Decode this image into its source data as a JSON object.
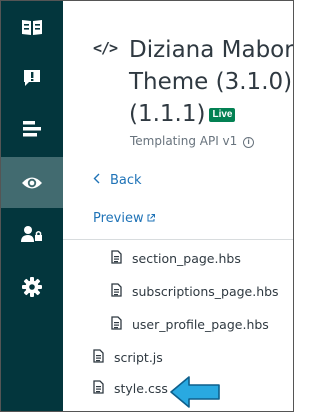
{
  "sidebar": {
    "items": [
      {
        "name": "guide-book-icon"
      },
      {
        "name": "alert-icon"
      },
      {
        "name": "layout-icon"
      },
      {
        "name": "eye-icon",
        "active": true
      },
      {
        "name": "user-lock-icon"
      },
      {
        "name": "gear-icon"
      }
    ]
  },
  "header": {
    "code_icon": "</>",
    "title_line1": "Diziana Mabor",
    "title_line2": "Theme (3.1.0)",
    "title_line3": "(1.1.1)",
    "badge": "Live",
    "subtitle": "Templating API v1",
    "info_icon": "i"
  },
  "nav": {
    "back_label": "Back",
    "preview_label": "Preview"
  },
  "files": {
    "templates": [
      "section_page.hbs",
      "subscriptions_page.hbs",
      "user_profile_page.hbs"
    ],
    "root": [
      "script.js",
      "style.css"
    ]
  },
  "colors": {
    "sidebar": "#03363d",
    "sidebar_active": "#426b70",
    "link": "#1f73b7",
    "badge": "#038153",
    "arrow": "#29a9e1"
  }
}
